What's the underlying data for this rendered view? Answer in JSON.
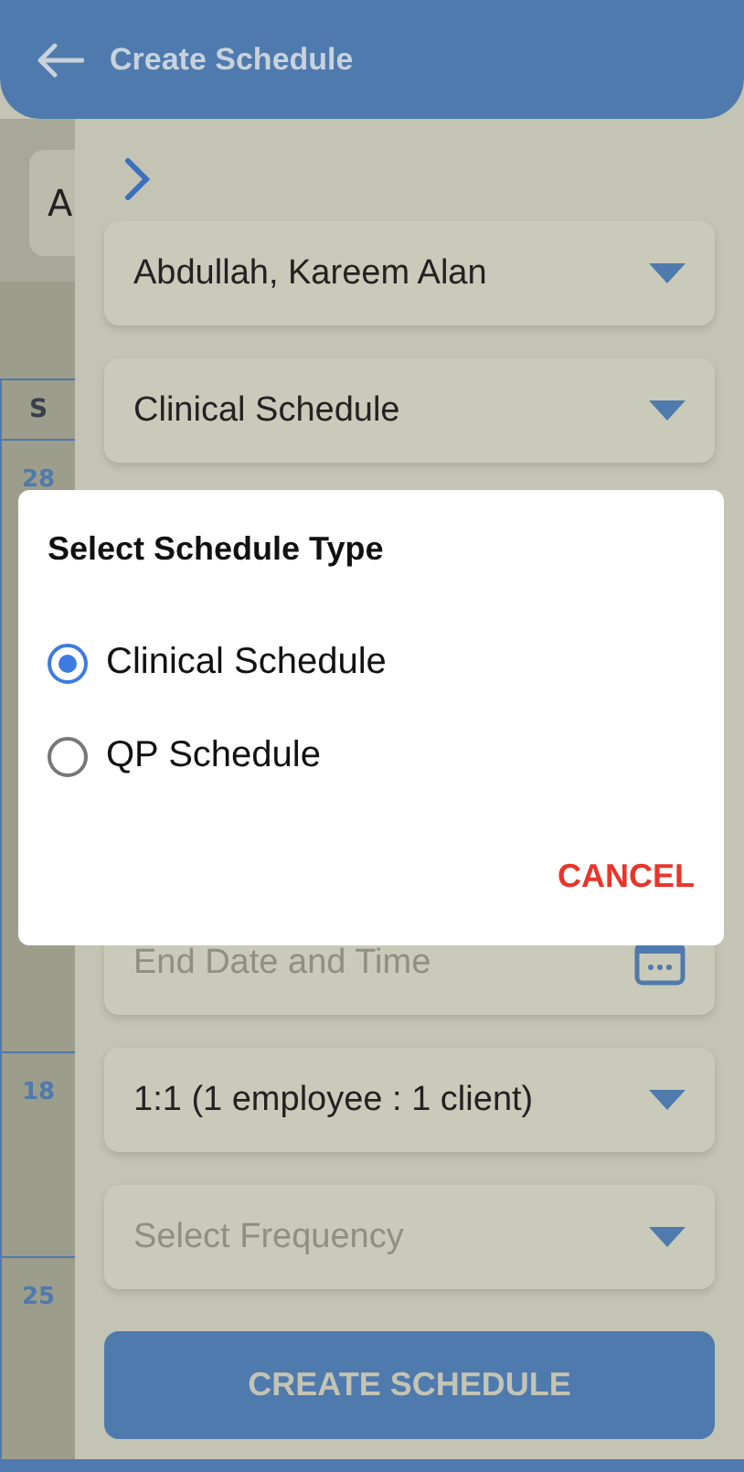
{
  "header": {
    "title": "Create Schedule"
  },
  "background": {
    "card_text": "A",
    "weekday": "S",
    "dates": [
      "28",
      "18",
      "25"
    ]
  },
  "form": {
    "fields": [
      {
        "kind": "select",
        "value": "Abdullah, Kareem Alan"
      },
      {
        "kind": "select",
        "value": "Clinical Schedule"
      },
      {
        "kind": "date",
        "placeholder": "End Date and Time"
      },
      {
        "kind": "select",
        "value": "1:1 (1 employee : 1 client)"
      },
      {
        "kind": "select",
        "placeholder": "Select Frequency"
      }
    ],
    "submit": "CREATE SCHEDULE"
  },
  "dialog": {
    "title": "Select Schedule Type",
    "options": [
      {
        "label": "Clinical Schedule",
        "selected": true
      },
      {
        "label": "QP Schedule",
        "selected": false
      }
    ],
    "cancel": "CANCEL"
  }
}
